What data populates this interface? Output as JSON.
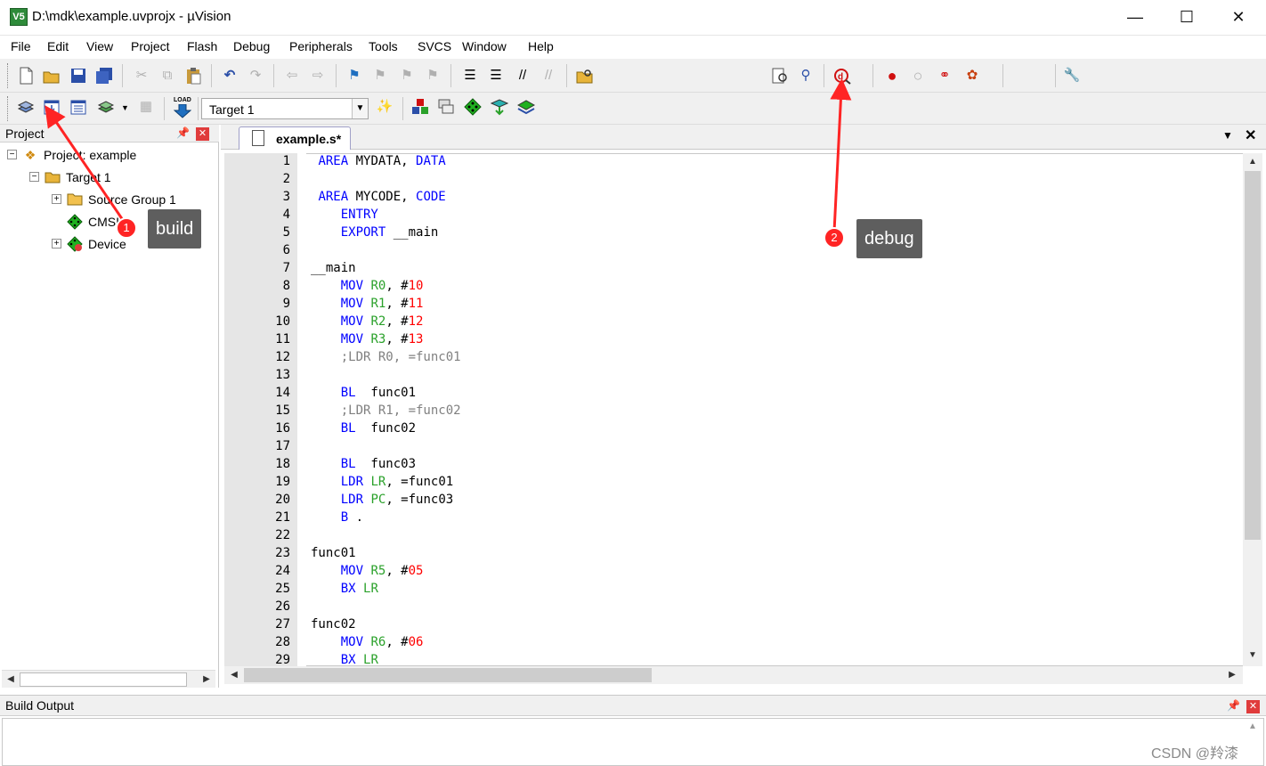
{
  "window": {
    "title": "D:\\mdk\\example.uvprojx - µVision",
    "app_icon_text": "V5",
    "minimize_glyph": "—",
    "maximize_glyph": "☐",
    "close_glyph": "✕"
  },
  "menu": [
    "File",
    "Edit",
    "View",
    "Project",
    "Flash",
    "Debug",
    "Peripherals",
    "Tools",
    "SVCS",
    "Window",
    "Help"
  ],
  "toolbar2": {
    "target_value": "Target 1",
    "load_label": "LOAD"
  },
  "project_pane": {
    "title": "Project",
    "tree": {
      "root": "Project: example",
      "target": "Target 1",
      "source_group": "Source Group 1",
      "cmsis": "CMSIS",
      "device": "Device"
    }
  },
  "editor": {
    "tab": "example.s*",
    "lines": [
      {
        "n": "1",
        "code": " AREA MYDATA, DATA"
      },
      {
        "n": "2",
        "code": ""
      },
      {
        "n": "3",
        "code": " AREA MYCODE, CODE"
      },
      {
        "n": "4",
        "code": "    ENTRY"
      },
      {
        "n": "5",
        "code": "    EXPORT __main"
      },
      {
        "n": "6",
        "code": ""
      },
      {
        "n": "7",
        "code": "__main"
      },
      {
        "n": "8",
        "code": "    MOV R0, #10"
      },
      {
        "n": "9",
        "code": "    MOV R1, #11"
      },
      {
        "n": "10",
        "code": "    MOV R2, #12"
      },
      {
        "n": "11",
        "code": "    MOV R3, #13"
      },
      {
        "n": "12",
        "code": "    ;LDR R0, =func01"
      },
      {
        "n": "13",
        "code": ""
      },
      {
        "n": "14",
        "code": "    BL  func01"
      },
      {
        "n": "15",
        "code": "    ;LDR R1, =func02"
      },
      {
        "n": "16",
        "code": "    BL  func02"
      },
      {
        "n": "17",
        "code": ""
      },
      {
        "n": "18",
        "code": "    BL  func03"
      },
      {
        "n": "19",
        "code": "    LDR LR, =func01"
      },
      {
        "n": "20",
        "code": "    LDR PC, =func03"
      },
      {
        "n": "21",
        "code": "    B ."
      },
      {
        "n": "22",
        "code": ""
      },
      {
        "n": "23",
        "code": "func01"
      },
      {
        "n": "24",
        "code": "    MOV R5, #05"
      },
      {
        "n": "25",
        "code": "    BX LR"
      },
      {
        "n": "26",
        "code": ""
      },
      {
        "n": "27",
        "code": "func02"
      },
      {
        "n": "28",
        "code": "    MOV R6, #06"
      },
      {
        "n": "29",
        "code": "    BX LR"
      }
    ]
  },
  "build_output": {
    "title": "Build Output"
  },
  "annotations": {
    "build": {
      "number": "1",
      "label": "build"
    },
    "debug": {
      "number": "2",
      "label": "debug"
    }
  },
  "watermark": "CSDN @羚漆",
  "colors": {
    "keyword": "#0000ff",
    "register": "#2aa12a",
    "number": "#ff0000",
    "comment": "#808080",
    "annotation_red": "#ff2424",
    "annotation_label_bg": "#5e5e5e"
  }
}
